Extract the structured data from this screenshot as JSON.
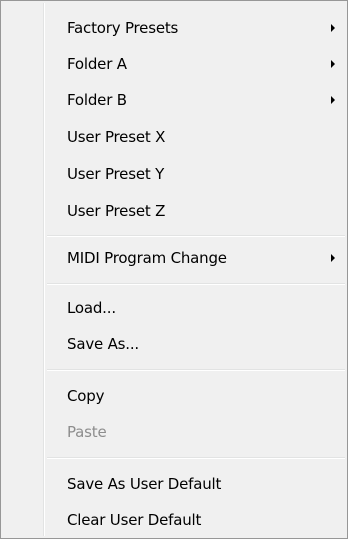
{
  "menu": {
    "items": [
      {
        "label": "Factory Presets",
        "submenu_arrow": "triangle-right-icon"
      },
      {
        "label": "Folder A",
        "submenu_arrow": "triangle-right-icon"
      },
      {
        "label": "Folder B",
        "submenu_arrow": "triangle-right-icon"
      },
      {
        "label": "User Preset X"
      },
      {
        "label": "User Preset Y"
      },
      {
        "label": "User Preset Z"
      },
      {
        "label": "MIDI Program Change",
        "submenu_arrow": "triangle-right-icon"
      },
      {
        "label": "Load..."
      },
      {
        "label": "Save As..."
      },
      {
        "label": "Copy"
      },
      {
        "label": "Paste",
        "enabled": false
      },
      {
        "label": "Save As User Default"
      },
      {
        "label": "Clear User Default"
      }
    ]
  },
  "colors": {
    "menu_background": "#f0f0f0",
    "border": "#979797",
    "separator": "#e2e3e3",
    "disabled_text": "#8d8d8d"
  }
}
